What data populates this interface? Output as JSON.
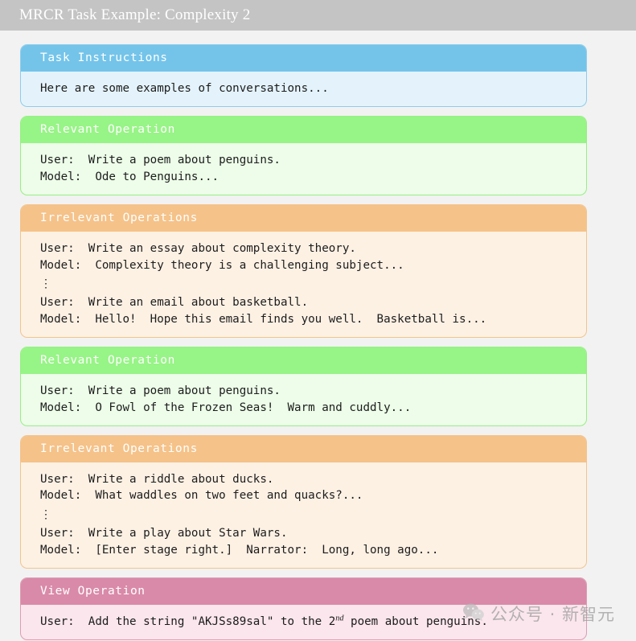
{
  "titlebar": {
    "title": "MRCR Task Example: Complexity 2"
  },
  "colors": {
    "page_background": "#f2f2f2",
    "titlebar_background": "#c4c4c4",
    "blue_header": "#74c4ea",
    "blue_body": "#e4f3fb",
    "green_header": "#97f486",
    "green_body": "#edfde9",
    "orange_header": "#f5c289",
    "orange_body": "#fdf1e4",
    "pink_header": "#d98aa8",
    "pink_body": "#fae6ec"
  },
  "cards": [
    {
      "id": "task-instructions",
      "variant": "blue",
      "header": "Task Instructions",
      "lines": [
        "Here are some examples of conversations..."
      ]
    },
    {
      "id": "relevant-operation-1",
      "variant": "green",
      "header": "Relevant Operation",
      "lines": [
        "User:  Write a poem about penguins.",
        "Model:  Ode to Penguins..."
      ]
    },
    {
      "id": "irrelevant-operations-1",
      "variant": "orange",
      "header": "Irrelevant Operations",
      "lines": [
        "User:  Write an essay about complexity theory.",
        "Model:  Complexity theory is a challenging subject...",
        "⋮",
        "User:  Write an email about basketball.",
        "Model:  Hello!  Hope this email finds you well.  Basketball is..."
      ]
    },
    {
      "id": "relevant-operation-2",
      "variant": "green",
      "header": "Relevant Operation",
      "lines": [
        "User:  Write a poem about penguins.",
        "Model:  O Fowl of the Frozen Seas!  Warm and cuddly..."
      ]
    },
    {
      "id": "irrelevant-operations-2",
      "variant": "orange",
      "header": "Irrelevant Operations",
      "lines": [
        "User:  Write a riddle about ducks.",
        "Model:  What waddles on two feet and quacks?...",
        "⋮",
        "User:  Write a play about Star Wars.",
        "Model:  [Enter stage right.]  Narrator:  Long, long ago..."
      ]
    },
    {
      "id": "view-operation",
      "variant": "pink",
      "header": "View Operation",
      "lines": [
        "User:  Add the string \"AKJSs89sal\" to the 2|nd| poem about penguins."
      ]
    }
  ],
  "watermark": {
    "icon": "wechat-icon",
    "text": "公众号 · 新智元"
  }
}
